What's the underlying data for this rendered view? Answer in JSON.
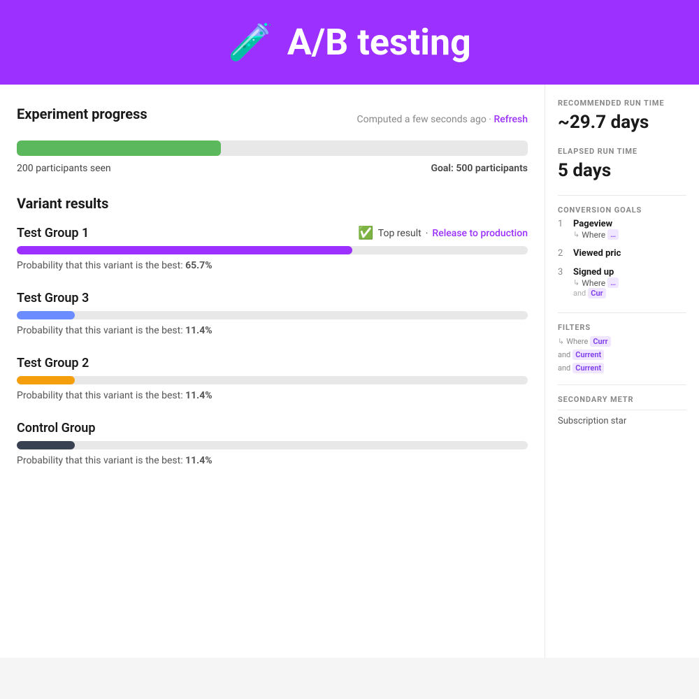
{
  "header": {
    "icon": "🧪",
    "title": "A/B testing"
  },
  "experiment": {
    "section_title": "Experiment progress",
    "computed_text": "Computed a few seconds ago",
    "dot_separator": "·",
    "refresh_label": "Refresh",
    "progress_percent": 40,
    "participants_seen": "200 participants seen",
    "goal_label": "Goal: 500 participants"
  },
  "variants": {
    "section_title": "Variant results",
    "groups": [
      {
        "name": "Test Group 1",
        "top_result": true,
        "top_result_label": "Top result",
        "release_label": "Release to production",
        "bar_class": "bar-purple",
        "probability_text": "Probability that this variant is the best:",
        "probability_value": "65.7%"
      },
      {
        "name": "Test Group 3",
        "top_result": false,
        "bar_class": "bar-blue",
        "probability_text": "Probability that this variant is the best:",
        "probability_value": "11.4%"
      },
      {
        "name": "Test Group 2",
        "top_result": false,
        "bar_class": "bar-yellow",
        "probability_text": "Probability that this variant is the best:",
        "probability_value": "11.4%"
      },
      {
        "name": "Control Group",
        "top_result": false,
        "bar_class": "bar-dark",
        "probability_text": "Probability that this variant is the best:",
        "probability_value": "11.4%"
      }
    ]
  },
  "sidebar": {
    "recommended_run_time_label": "RECOMMENDED RUN TIME",
    "recommended_run_time_value": "~29.7 days",
    "elapsed_run_time_label": "ELAPSED RUN TIME",
    "elapsed_run_time_value": "5 days",
    "conversion_goals_label": "CONVERSION GOALS",
    "goals": [
      {
        "number": "1",
        "name": "Pageview",
        "where_label": "Where",
        "where_value": ""
      },
      {
        "number": "2",
        "name": "Viewed pric",
        "where_label": "",
        "where_value": ""
      },
      {
        "number": "3",
        "name": "Signed up",
        "where_label": "Where",
        "where_value": "",
        "and_label": "and",
        "and_value": "Cur"
      }
    ],
    "filters_label": "FILTERS",
    "filters": [
      {
        "prefix": "",
        "where_label": "Where",
        "value": "Curr"
      },
      {
        "prefix": "and",
        "value": "Current"
      },
      {
        "prefix": "and",
        "value": "Current"
      }
    ],
    "secondary_metrics_label": "SECONDARY METR",
    "secondary_metrics": [
      {
        "name": "Subscription star"
      }
    ]
  }
}
